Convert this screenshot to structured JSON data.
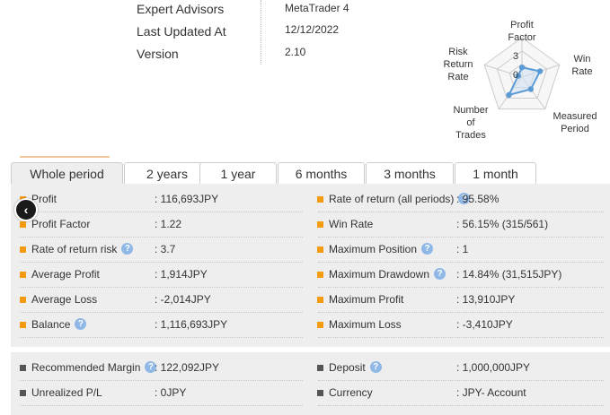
{
  "info": {
    "expert_advisors_label": "Expert Advisors",
    "expert_advisors_value": "MetaTrader 4",
    "last_updated_label": "Last Updated At",
    "last_updated_value": "12/12/2022",
    "version_label": "Version",
    "version_value": "2.10"
  },
  "radar": {
    "axes": [
      {
        "label_lines": [
          "Profit",
          "Factor"
        ],
        "value": 1.22
      },
      {
        "label_lines": [
          "Win",
          "Rate"
        ],
        "value": 2.4
      },
      {
        "label_lines": [
          "Measured",
          "Period"
        ],
        "value": 1.9
      },
      {
        "label_lines": [
          "Number",
          "of",
          "Trades"
        ],
        "value": 2.8
      },
      {
        "label_lines": [
          "Risk",
          "Return",
          "Rate"
        ],
        "value": 0.5
      }
    ],
    "scale_max_label": "3",
    "scale_min_label": "0",
    "max": 5,
    "colors": {
      "fill": "#cfe2f5",
      "line": "#5b9bd5",
      "grid": "#cccccc"
    }
  },
  "tabs": [
    {
      "label": "Whole period",
      "active": true
    },
    {
      "label": "2 years",
      "active": false
    },
    {
      "label": "1 year",
      "active": false
    },
    {
      "label": "6 months",
      "active": false
    },
    {
      "label": "3 months",
      "active": false
    },
    {
      "label": "1 month",
      "active": false
    }
  ],
  "stats_left": [
    {
      "label": "Profit",
      "value": ": 116,693JPY",
      "help": false
    },
    {
      "label": "Profit Factor",
      "value": ": 1.22",
      "help": false
    },
    {
      "label": "Rate of return risk",
      "value": ": 3.7",
      "help": true
    },
    {
      "label": "Average Profit",
      "value": ": 1,914JPY",
      "help": false
    },
    {
      "label": "Average Loss",
      "value": ": -2,014JPY",
      "help": false
    },
    {
      "label": "Balance",
      "value": ": 1,116,693JPY",
      "help": true
    }
  ],
  "stats_right": [
    {
      "label": "Rate of return (all periods)",
      "value": ": 95.58%",
      "help": true
    },
    {
      "label": "Win Rate",
      "value": ": 56.15% (315/561)",
      "help": false
    },
    {
      "label": "Maximum Position",
      "value": ": 1",
      "help": true
    },
    {
      "label": "Maximum Drawdown",
      "value": ": 14.84% (31,515JPY)",
      "help": true
    },
    {
      "label": "Maximum Profit",
      "value": ": 13,910JPY",
      "help": false
    },
    {
      "label": "Maximum Loss",
      "value": ": -3,410JPY",
      "help": false
    }
  ],
  "extra_left": [
    {
      "label": "Recommended Margin",
      "value": ": 122,092JPY",
      "help": true
    },
    {
      "label": "Unrealized P/L",
      "value": ": 0JPY",
      "help": false
    }
  ],
  "extra_right": [
    {
      "label": "Deposit",
      "value": ": 1,000,000JPY",
      "help": true
    },
    {
      "label": "Currency",
      "value": ": JPY- Account",
      "help": false
    }
  ],
  "help_glyph": "?",
  "back_glyph": "‹",
  "colors": {
    "bullet_stats": "#f39c12",
    "bullet_extra": "#555555",
    "panel_bg": "#eeeeee",
    "help_icon": "#8fb8e6"
  }
}
